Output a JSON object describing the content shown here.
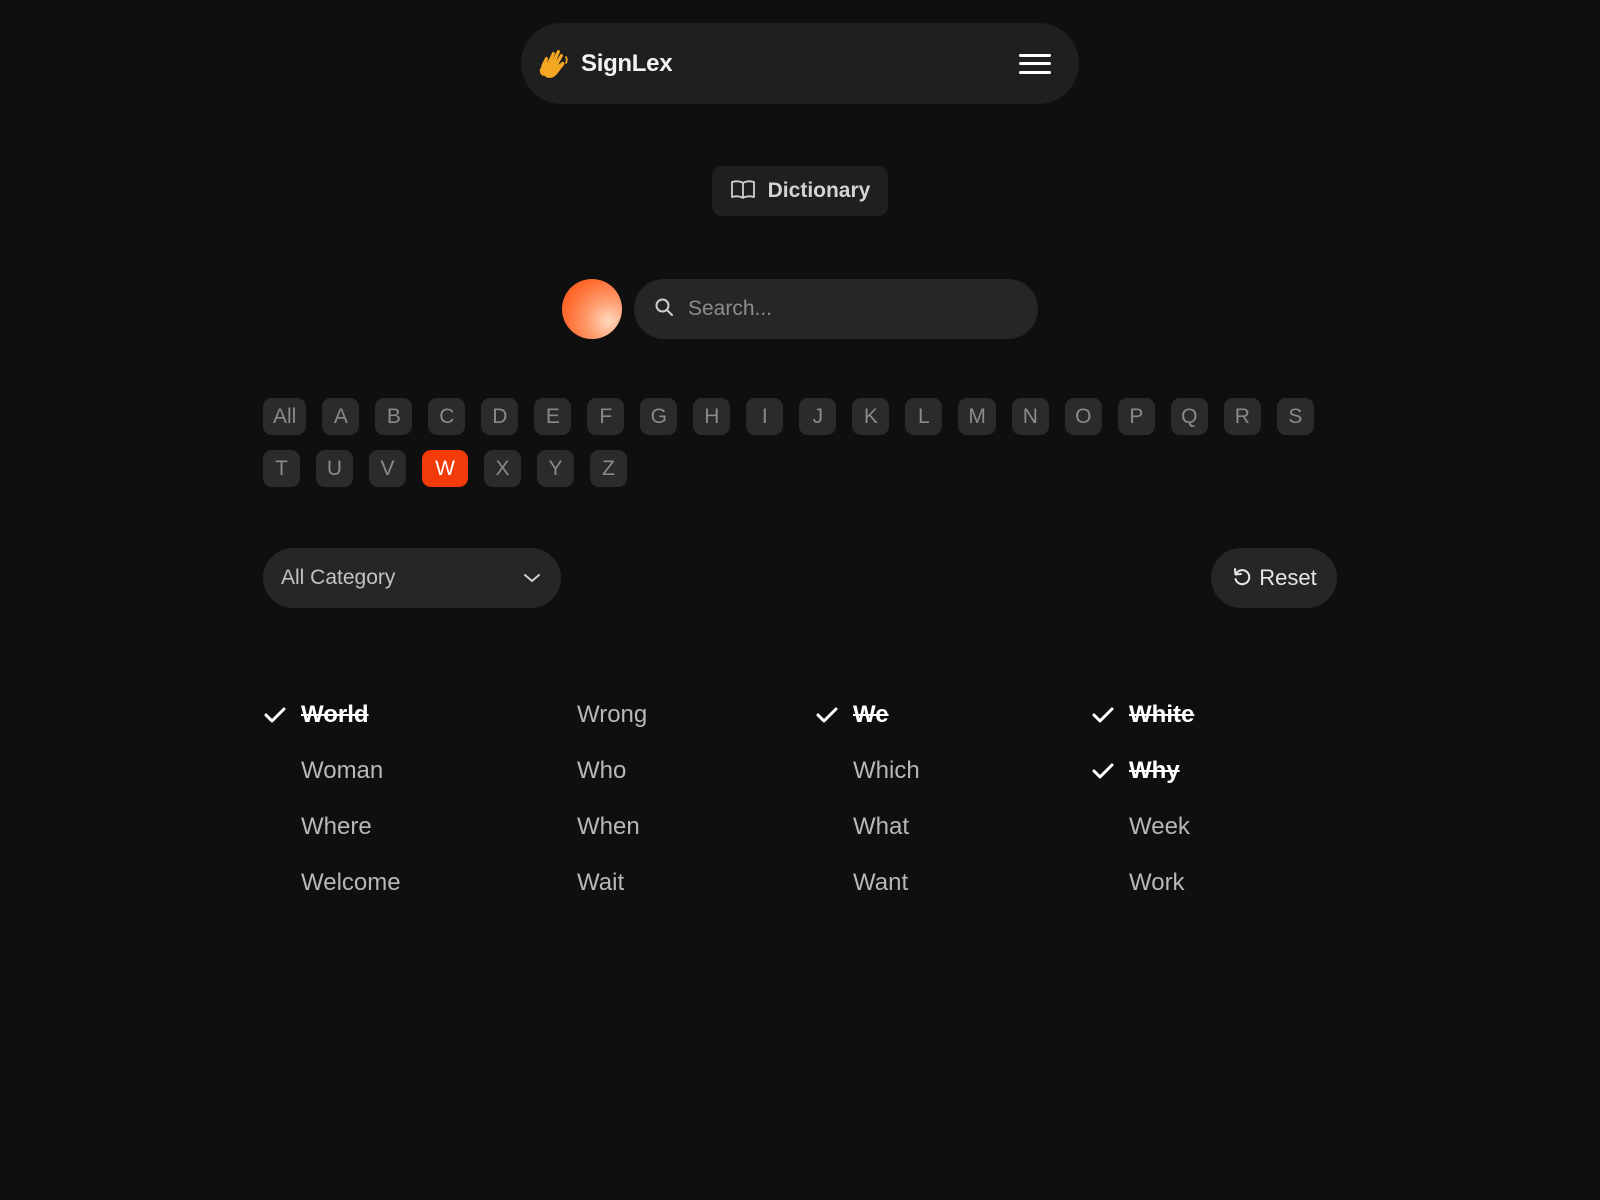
{
  "app": {
    "name": "SignLex",
    "logo_icon": "waving-hand-icon",
    "menu_icon": "hamburger-menu-icon"
  },
  "section": {
    "label": "Dictionary",
    "icon": "open-book-icon"
  },
  "search": {
    "placeholder": "Search...",
    "value": "",
    "icon": "search-icon"
  },
  "alphabet": {
    "letters": [
      "All",
      "A",
      "B",
      "C",
      "D",
      "E",
      "F",
      "G",
      "H",
      "I",
      "J",
      "K",
      "L",
      "M",
      "N",
      "O",
      "P",
      "Q",
      "R",
      "S",
      "T",
      "U",
      "V",
      "W",
      "X",
      "Y",
      "Z"
    ],
    "selected": "W"
  },
  "filters": {
    "category": "All Category",
    "category_icon": "chevron-down-icon",
    "reset_label": "Reset",
    "reset_icon": "reset-icon"
  },
  "words": [
    {
      "text": "World",
      "done": true
    },
    {
      "text": "Wrong",
      "done": false
    },
    {
      "text": "We",
      "done": true
    },
    {
      "text": "White",
      "done": true
    },
    {
      "text": "Woman",
      "done": false
    },
    {
      "text": "Who",
      "done": false
    },
    {
      "text": "Which",
      "done": false
    },
    {
      "text": "Why",
      "done": true
    },
    {
      "text": "Where",
      "done": false
    },
    {
      "text": "When",
      "done": false
    },
    {
      "text": "What",
      "done": false
    },
    {
      "text": "Week",
      "done": false
    },
    {
      "text": "Welcome",
      "done": false
    },
    {
      "text": "Wait",
      "done": false
    },
    {
      "text": "Want",
      "done": false
    },
    {
      "text": "Work",
      "done": false
    }
  ],
  "colors": {
    "accent": "#f23a0a",
    "background": "#0f0f0f",
    "surface": "#1f1f1f"
  }
}
